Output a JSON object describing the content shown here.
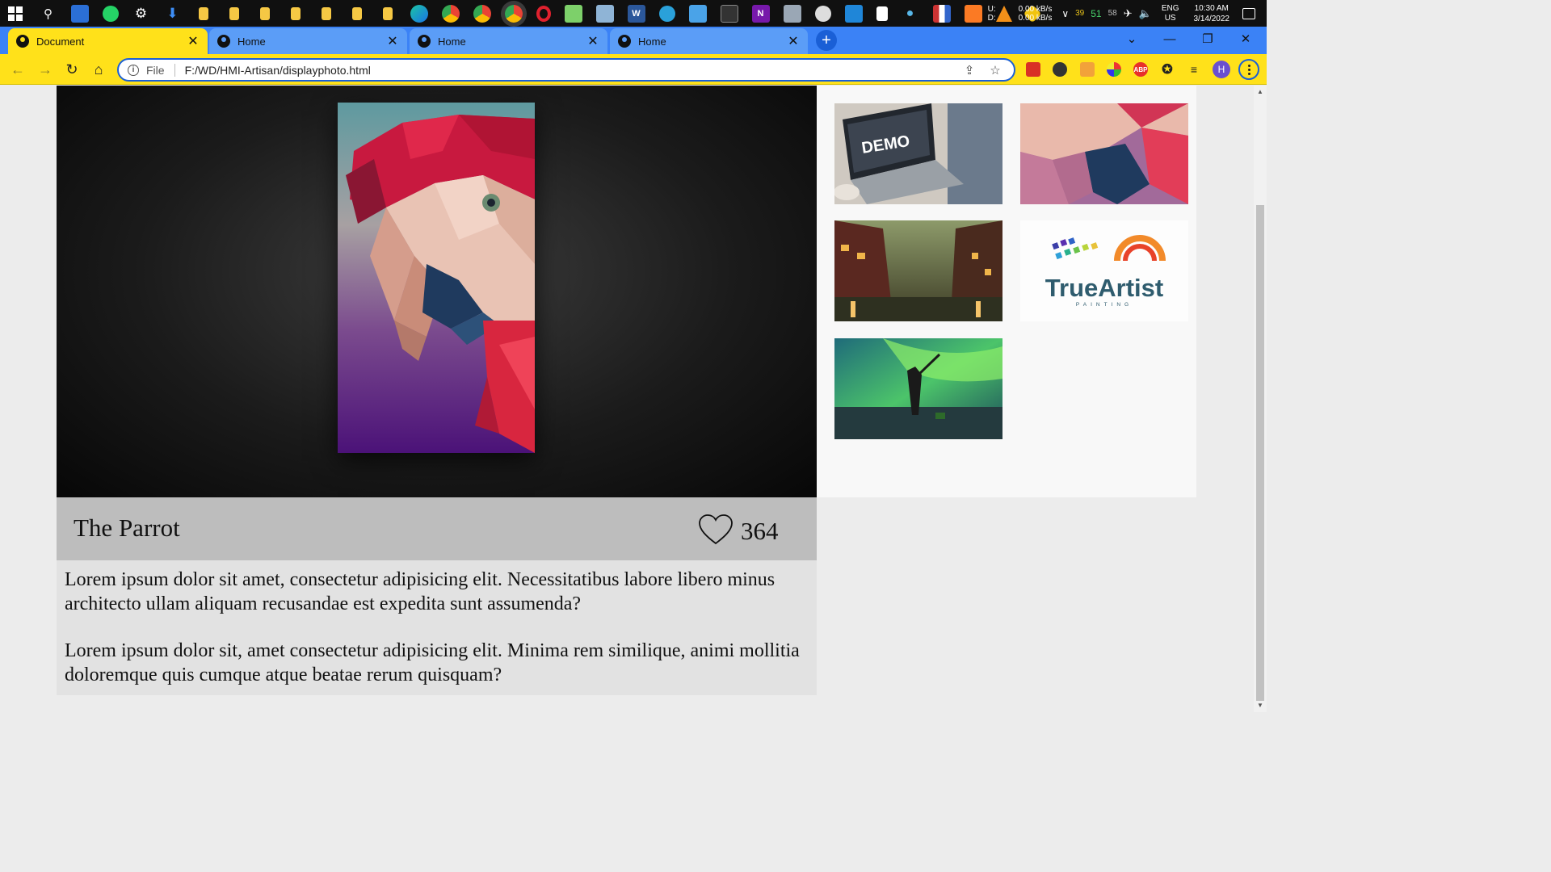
{
  "taskbar": {
    "net_upload": "0.00 kB/s",
    "net_download": "0.00 kB/s",
    "net_up_label": "U:",
    "net_down_label": "D:",
    "cpu": "39",
    "ram": "51",
    "temp": "58",
    "lang_top": "ENG",
    "lang_bottom": "US",
    "time": "10:30 AM",
    "date": "3/14/2022"
  },
  "browser": {
    "tabs": [
      {
        "label": "Document",
        "active": true
      },
      {
        "label": "Home",
        "active": false
      },
      {
        "label": "Home",
        "active": false
      },
      {
        "label": "Home",
        "active": false
      }
    ],
    "address": {
      "scheme": "File",
      "url": "F:/WD/HMI-Artisan/displayphoto.html"
    },
    "profile_initial": "H",
    "ext_abp": "ABP"
  },
  "artwork": {
    "title": "The Parrot",
    "likes": "364",
    "description": [
      "Lorem ipsum dolor sit amet, consectetur adipisicing elit. Necessitatibus labore libero minus architecto ullam aliquam recusandae est expedita sunt assumenda?",
      "Lorem ipsum dolor sit, amet consectetur adipisicing elit. Minima rem similique, animi mollitia doloremque quis cumque atque beatae rerum quisquam?"
    ]
  },
  "gallery": {
    "thumbnails": [
      {
        "name": "demo-laptop",
        "text": "DEMO"
      },
      {
        "name": "parrot-crop"
      },
      {
        "name": "city-street-painting"
      },
      {
        "name": "trueartist-logo",
        "brand": "TrueArtist",
        "tagline": "PAINTING"
      },
      {
        "name": "green-aurora-painting"
      }
    ]
  },
  "colors": {
    "tab_active": "#ffe11a",
    "tab_strip": "#3b82f6",
    "accent_blue": "#1a5fd6"
  }
}
